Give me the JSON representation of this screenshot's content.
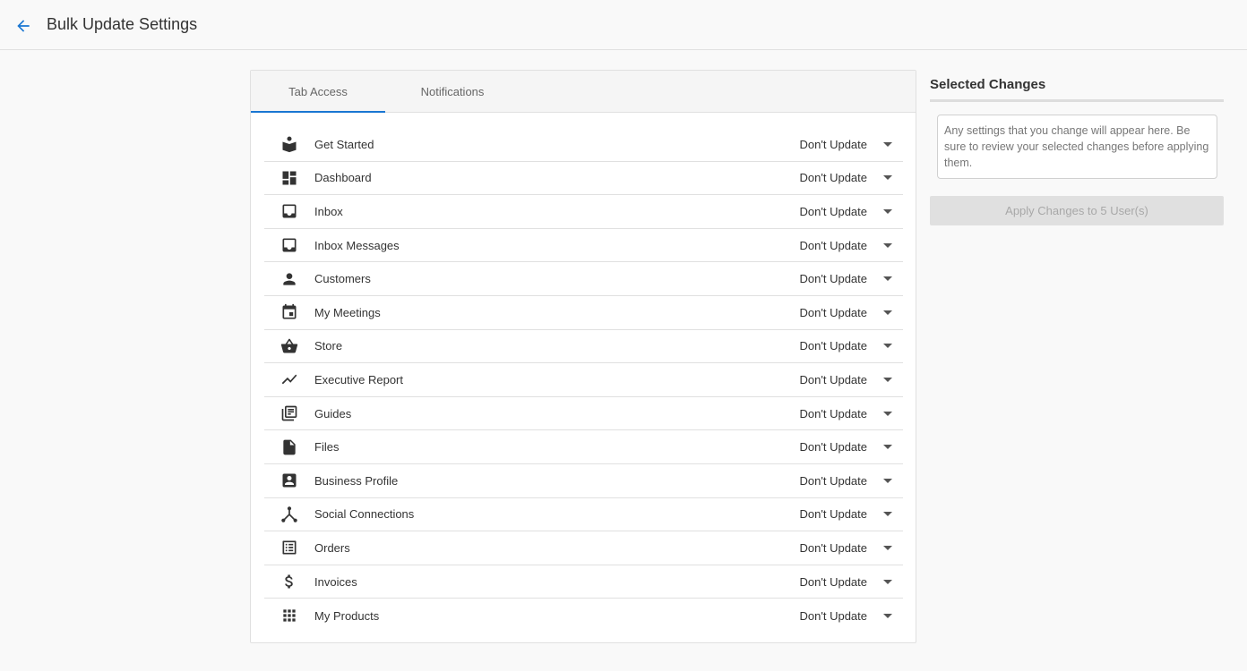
{
  "header": {
    "title": "Bulk Update Settings"
  },
  "tabs": [
    {
      "label": "Tab Access",
      "active": true
    },
    {
      "label": "Notifications",
      "active": false
    }
  ],
  "rows": [
    {
      "label": "Get Started",
      "value": "Don't Update",
      "icon": "book-reader-icon"
    },
    {
      "label": "Dashboard",
      "value": "Don't Update",
      "icon": "dashboard-icon"
    },
    {
      "label": "Inbox",
      "value": "Don't Update",
      "icon": "inbox-icon"
    },
    {
      "label": "Inbox Messages",
      "value": "Don't Update",
      "icon": "inbox-icon"
    },
    {
      "label": "Customers",
      "value": "Don't Update",
      "icon": "person-icon"
    },
    {
      "label": "My Meetings",
      "value": "Don't Update",
      "icon": "calendar-icon"
    },
    {
      "label": "Store",
      "value": "Don't Update",
      "icon": "basket-icon"
    },
    {
      "label": "Executive Report",
      "value": "Don't Update",
      "icon": "trending-line-icon"
    },
    {
      "label": "Guides",
      "value": "Don't Update",
      "icon": "library-books-icon"
    },
    {
      "label": "Files",
      "value": "Don't Update",
      "icon": "file-icon"
    },
    {
      "label": "Business Profile",
      "value": "Don't Update",
      "icon": "account-box-icon"
    },
    {
      "label": "Social Connections",
      "value": "Don't Update",
      "icon": "share-network-icon"
    },
    {
      "label": "Orders",
      "value": "Don't Update",
      "icon": "list-alt-icon"
    },
    {
      "label": "Invoices",
      "value": "Don't Update",
      "icon": "dollar-icon"
    },
    {
      "label": "My Products",
      "value": "Don't Update",
      "icon": "apps-grid-icon"
    }
  ],
  "side": {
    "title": "Selected Changes",
    "note": "Any settings that you change will appear here. Be sure to review your selected changes before applying them.",
    "apply_label": "Apply Changes to 5 User(s)"
  },
  "colors": {
    "accent": "#1976d2",
    "icon": "#333333",
    "disabled_bg": "#e0e0e0"
  }
}
